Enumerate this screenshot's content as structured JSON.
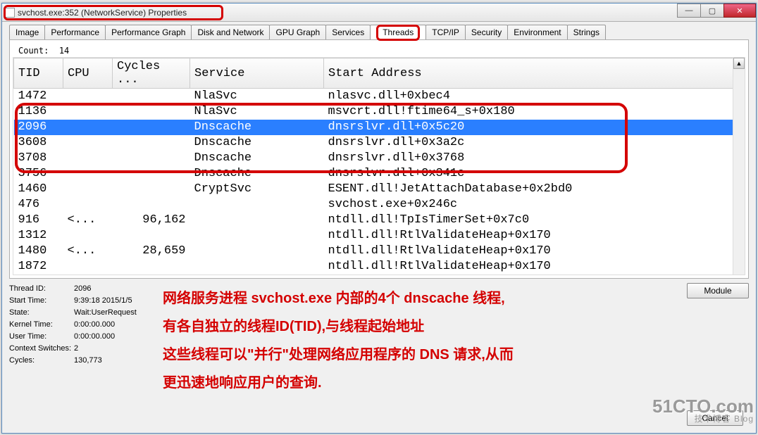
{
  "window": {
    "title": "svchost.exe:352 (NetworkService) Properties"
  },
  "tabs": [
    "Image",
    "Performance",
    "Performance Graph",
    "Disk and Network",
    "GPU Graph",
    "Services",
    "Threads",
    "TCP/IP",
    "Security",
    "Environment",
    "Strings"
  ],
  "selected_tab": "Threads",
  "threads": {
    "count_label": "Count:",
    "count_value": "14",
    "columns": [
      "TID",
      "CPU",
      "Cycles ...",
      "Service",
      "Start Address"
    ],
    "rows": [
      {
        "tid": "1472",
        "cpu": "",
        "cycles": "",
        "service": "NlaSvc",
        "start": "nlasvc.dll+0xbec4",
        "sel": false
      },
      {
        "tid": "1136",
        "cpu": "",
        "cycles": "",
        "service": "NlaSvc",
        "start": "msvcrt.dll!ftime64_s+0x180",
        "sel": false
      },
      {
        "tid": "2096",
        "cpu": "",
        "cycles": "",
        "service": "Dnscache",
        "start": "dnsrslvr.dll+0x5c20",
        "sel": true
      },
      {
        "tid": "3608",
        "cpu": "",
        "cycles": "",
        "service": "Dnscache",
        "start": "dnsrslvr.dll+0x3a2c",
        "sel": false
      },
      {
        "tid": "3708",
        "cpu": "",
        "cycles": "",
        "service": "Dnscache",
        "start": "dnsrslvr.dll+0x3768",
        "sel": false
      },
      {
        "tid": "3756",
        "cpu": "",
        "cycles": "",
        "service": "Dnscache",
        "start": "dnsrslvr.dll+0x341c",
        "sel": false
      },
      {
        "tid": "1460",
        "cpu": "",
        "cycles": "",
        "service": "CryptSvc",
        "start": "ESENT.dll!JetAttachDatabase+0x2bd0",
        "sel": false
      },
      {
        "tid": "476",
        "cpu": "",
        "cycles": "",
        "service": "",
        "start": "svchost.exe+0x246c",
        "sel": false
      },
      {
        "tid": "916",
        "cpu": "<...",
        "cycles": "96,162",
        "service": "",
        "start": "ntdll.dll!TpIsTimerSet+0x7c0",
        "sel": false
      },
      {
        "tid": "1312",
        "cpu": "",
        "cycles": "",
        "service": "",
        "start": "ntdll.dll!RtlValidateHeap+0x170",
        "sel": false
      },
      {
        "tid": "1480",
        "cpu": "<...",
        "cycles": "28,659",
        "service": "",
        "start": "ntdll.dll!RtlValidateHeap+0x170",
        "sel": false
      },
      {
        "tid": "1872",
        "cpu": "",
        "cycles": "",
        "service": "",
        "start": "ntdll.dll!RtlValidateHeap+0x170",
        "sel": false
      }
    ]
  },
  "details": {
    "labels": {
      "thread_id": "Thread ID:",
      "start_time": "Start Time:",
      "state": "State:",
      "kernel_time": "Kernel Time:",
      "user_time": "User Time:",
      "context_switches": "Context Switches:",
      "cycles": "Cycles:"
    },
    "values": {
      "thread_id": "2096",
      "start_time": "9:39:18  2015/1/5",
      "state": "Wait:UserRequest",
      "kernel_time": "0:00:00.000",
      "user_time": "0:00:00.000",
      "context_switches": "2",
      "cycles": "130,773"
    }
  },
  "buttons": {
    "module": "Module",
    "cancel": "Cancel"
  },
  "annotation": {
    "line1": "网络服务进程 svchost.exe 内部的4个 dnscache 线程,",
    "line2": "有各自独立的线程ID(TID),与线程起始地址",
    "line3": "这些线程可以\"并行\"处理网络应用程序的 DNS 请求,从而",
    "line4": "更迅速地响应用户的查询."
  },
  "watermark": {
    "big": "51CTO.com",
    "small": "技术博客        Blog"
  }
}
